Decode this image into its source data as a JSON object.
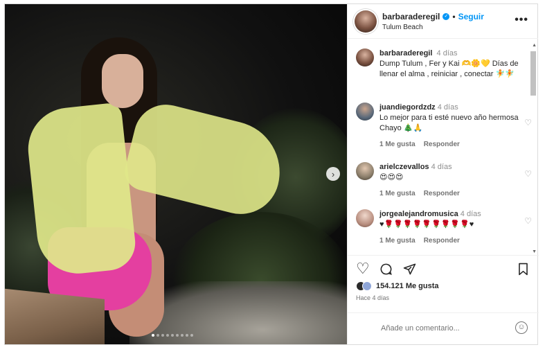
{
  "post": {
    "username": "barbaraderegil",
    "follow_label": "Seguir",
    "separator": "•",
    "location": "Tulum Beach",
    "more_label": "•••",
    "next_label": "›",
    "carousel": {
      "count": 9,
      "active_index": 0
    }
  },
  "caption": {
    "username": "barbaraderegil",
    "time": "4 días",
    "text": "Dump Tulum , Fer y Kai 🫶🌼💛 Días de llenar el alma , reiniciar , conectar 🧚🧚"
  },
  "comments": [
    {
      "username": "juandiegordzdz",
      "time": "4 días",
      "text": "Lo mejor para ti esté nuevo año hermosa Chayo 🎄🙏",
      "likes": "1 Me gusta",
      "reply": "Responder"
    },
    {
      "username": "arielczevallos",
      "time": "4 días",
      "text": "😍😍😍",
      "likes": "1 Me gusta",
      "reply": "Responder"
    },
    {
      "username": "jorgealejandromusica",
      "time": "4 días",
      "text": "♥🌹🌹🌹🌹🌹🌹🌹🌹🌹♥",
      "likes": "1 Me gusta",
      "reply": "Responder"
    }
  ],
  "footer": {
    "likes": "154.121 Me gusta",
    "ago": "Hace 4 días",
    "comment_placeholder": "Añade un comentario...",
    "emoji_icon": "☺"
  },
  "icons": {
    "heart": "♡",
    "comment": "○",
    "share": "➤",
    "bookmark": "▯",
    "verified": "✓"
  },
  "colors": {
    "accent": "#0095f6",
    "text": "#262626",
    "muted": "#737373"
  }
}
